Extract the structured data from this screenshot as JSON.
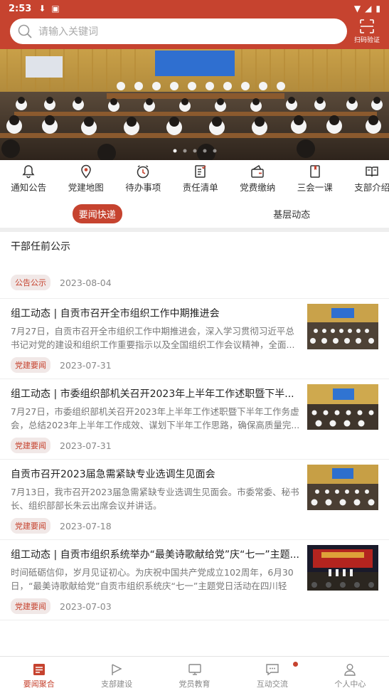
{
  "status_bar": {
    "time": "2:53"
  },
  "header": {
    "search_placeholder": "请输入关键词",
    "scan_label": "扫码验证"
  },
  "quick_links": [
    {
      "label": "通知公告",
      "icon": "bell-icon"
    },
    {
      "label": "党建地图",
      "icon": "map-pin-icon"
    },
    {
      "label": "待办事项",
      "icon": "clock-icon"
    },
    {
      "label": "责任清单",
      "icon": "checklist-icon"
    },
    {
      "label": "党费缴纳",
      "icon": "wallet-icon"
    },
    {
      "label": "三会一课",
      "icon": "bookmark-icon"
    },
    {
      "label": "支部介绍",
      "icon": "book-icon"
    }
  ],
  "tabs": [
    {
      "label": "要闻快递",
      "active": true
    },
    {
      "label": "基层动态",
      "active": false
    }
  ],
  "news": [
    {
      "title": "干部任前公示",
      "summary": "",
      "tag": "公告公示",
      "date": "2023-08-04",
      "has_image": false
    },
    {
      "title": "组工动态 | 自贡市召开全市组织工作中期推进会",
      "summary": "7月27日，自贡市召开全市组织工作中期推进会，深入学习贯彻习近平总书记对党的建设和组织工作重要指示以及全国组织工作会议精神，全面...",
      "tag": "党建要闻",
      "date": "2023-07-31",
      "has_image": true
    },
    {
      "title": "组工动态 | 市委组织部机关召开2023年上半年工作述职暨下半...",
      "summary": "7月27日，市委组织部机关召开2023年上半年工作述职暨下半年工作务虚会，总结2023年上半年工作成效、谋划下半年工作思路，确保高质量完...",
      "tag": "党建要闻",
      "date": "2023-07-31",
      "has_image": true
    },
    {
      "title": "自贡市召开2023届急需紧缺专业选调生见面会",
      "summary": "7月13日，我市召开2023届急需紧缺专业选调生见面会。市委常委、秘书长、组织部部长朱云出席会议并讲话。",
      "tag": "党建要闻",
      "date": "2023-07-18",
      "has_image": true
    },
    {
      "title": "组工动态 | 自贡市组织系统举办“最美诗歌献给党”庆“七一”主题...",
      "summary": "时间砥砺信仰，岁月见证初心。为庆祝中国共产党成立102周年，6月30日，“最美诗歌献给党”自贡市组织系统庆“七一”主题党日活动在四川轻化...",
      "tag": "党建要闻",
      "date": "2023-07-03",
      "has_image": true
    }
  ],
  "bottom_nav": [
    {
      "label": "要闻聚合",
      "icon": "news-icon",
      "active": true
    },
    {
      "label": "支部建设",
      "icon": "flag-icon",
      "active": false
    },
    {
      "label": "党员教育",
      "icon": "monitor-icon",
      "active": false
    },
    {
      "label": "互动交流",
      "icon": "chat-icon",
      "active": false
    },
    {
      "label": "个人中心",
      "icon": "person-icon",
      "active": false
    }
  ],
  "colors": {
    "brand": "#c6432f",
    "tag_bg": "#f1e8e7"
  }
}
